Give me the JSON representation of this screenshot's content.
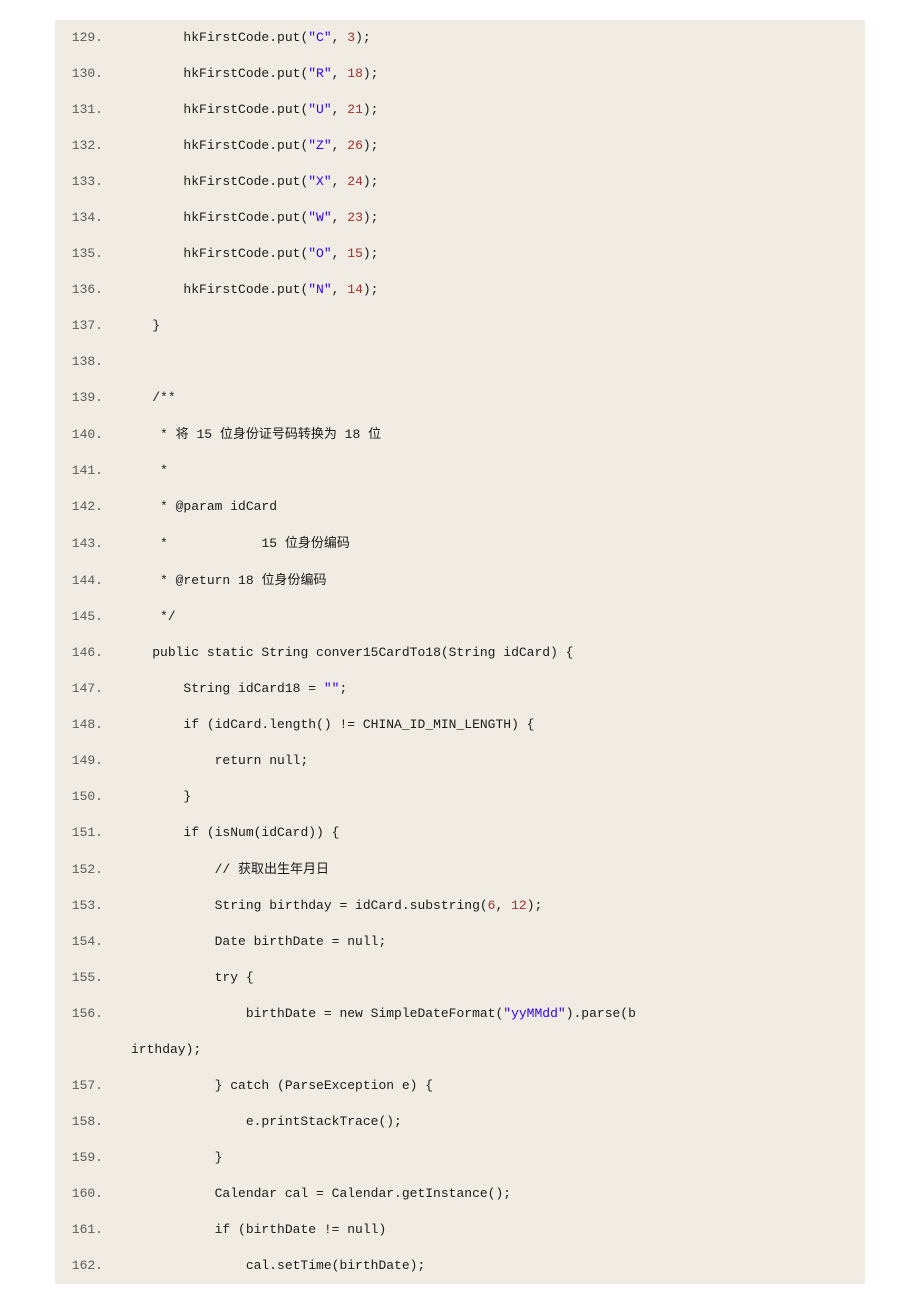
{
  "lines": [
    {
      "n": "129.",
      "indent": "        ",
      "segs": [
        {
          "t": "hkFirstCode.put("
        },
        {
          "t": "\"C\"",
          "c": "str"
        },
        {
          "t": ", "
        },
        {
          "t": "3",
          "c": "num"
        },
        {
          "t": ");"
        }
      ]
    },
    {
      "n": "130.",
      "indent": "        ",
      "segs": [
        {
          "t": "hkFirstCode.put("
        },
        {
          "t": "\"R\"",
          "c": "str"
        },
        {
          "t": ", "
        },
        {
          "t": "18",
          "c": "num"
        },
        {
          "t": ");"
        }
      ]
    },
    {
      "n": "131.",
      "indent": "        ",
      "segs": [
        {
          "t": "hkFirstCode.put("
        },
        {
          "t": "\"U\"",
          "c": "str"
        },
        {
          "t": ", "
        },
        {
          "t": "21",
          "c": "num"
        },
        {
          "t": ");"
        }
      ]
    },
    {
      "n": "132.",
      "indent": "        ",
      "segs": [
        {
          "t": "hkFirstCode.put("
        },
        {
          "t": "\"Z\"",
          "c": "str"
        },
        {
          "t": ", "
        },
        {
          "t": "26",
          "c": "num"
        },
        {
          "t": ");"
        }
      ]
    },
    {
      "n": "133.",
      "indent": "        ",
      "segs": [
        {
          "t": "hkFirstCode.put("
        },
        {
          "t": "\"X\"",
          "c": "str"
        },
        {
          "t": ", "
        },
        {
          "t": "24",
          "c": "num"
        },
        {
          "t": ");"
        }
      ]
    },
    {
      "n": "134.",
      "indent": "        ",
      "segs": [
        {
          "t": "hkFirstCode.put("
        },
        {
          "t": "\"W\"",
          "c": "str"
        },
        {
          "t": ", "
        },
        {
          "t": "23",
          "c": "num"
        },
        {
          "t": ");"
        }
      ]
    },
    {
      "n": "135.",
      "indent": "        ",
      "segs": [
        {
          "t": "hkFirstCode.put("
        },
        {
          "t": "\"O\"",
          "c": "str"
        },
        {
          "t": ", "
        },
        {
          "t": "15",
          "c": "num"
        },
        {
          "t": ");"
        }
      ]
    },
    {
      "n": "136.",
      "indent": "        ",
      "segs": [
        {
          "t": "hkFirstCode.put("
        },
        {
          "t": "\"N\"",
          "c": "str"
        },
        {
          "t": ", "
        },
        {
          "t": "14",
          "c": "num"
        },
        {
          "t": ");"
        }
      ]
    },
    {
      "n": "137.",
      "indent": "    ",
      "segs": [
        {
          "t": "}"
        }
      ]
    },
    {
      "n": "138.",
      "indent": "",
      "segs": [
        {
          "t": ""
        }
      ]
    },
    {
      "n": "139.",
      "indent": "    ",
      "segs": [
        {
          "t": "/**"
        }
      ]
    },
    {
      "n": "140.",
      "indent": "     ",
      "segs": [
        {
          "t": "* "
        },
        {
          "t": "将",
          "c": "cjk"
        },
        {
          "t": " 15 "
        },
        {
          "t": "位身份证号码转换为",
          "c": "cjk"
        },
        {
          "t": " 18 "
        },
        {
          "t": "位",
          "c": "cjk"
        }
      ]
    },
    {
      "n": "141.",
      "indent": "     ",
      "segs": [
        {
          "t": "*"
        }
      ]
    },
    {
      "n": "142.",
      "indent": "     ",
      "segs": [
        {
          "t": "* @param idCard"
        }
      ]
    },
    {
      "n": "143.",
      "indent": "     ",
      "segs": [
        {
          "t": "*            15 "
        },
        {
          "t": "位身份编码",
          "c": "cjk"
        }
      ]
    },
    {
      "n": "144.",
      "indent": "     ",
      "segs": [
        {
          "t": "* @return 18 "
        },
        {
          "t": "位身份编码",
          "c": "cjk"
        }
      ]
    },
    {
      "n": "145.",
      "indent": "     ",
      "segs": [
        {
          "t": "*/"
        }
      ]
    },
    {
      "n": "146.",
      "indent": "    ",
      "segs": [
        {
          "t": "public static String conver15CardTo18(String idCard) {"
        }
      ]
    },
    {
      "n": "147.",
      "indent": "        ",
      "segs": [
        {
          "t": "String idCard18 = "
        },
        {
          "t": "\"\"",
          "c": "str"
        },
        {
          "t": ";"
        }
      ]
    },
    {
      "n": "148.",
      "indent": "        ",
      "segs": [
        {
          "t": "if (idCard.length() != CHINA_ID_MIN_LENGTH) {"
        }
      ]
    },
    {
      "n": "149.",
      "indent": "            ",
      "segs": [
        {
          "t": "return null;"
        }
      ]
    },
    {
      "n": "150.",
      "indent": "        ",
      "segs": [
        {
          "t": "}"
        }
      ]
    },
    {
      "n": "151.",
      "indent": "        ",
      "segs": [
        {
          "t": "if (isNum(idCard)) {"
        }
      ]
    },
    {
      "n": "152.",
      "indent": "            ",
      "segs": [
        {
          "t": "// "
        },
        {
          "t": "获取出生年月日",
          "c": "cjk"
        }
      ]
    },
    {
      "n": "153.",
      "indent": "            ",
      "segs": [
        {
          "t": "String birthday = idCard.substring("
        },
        {
          "t": "6",
          "c": "num"
        },
        {
          "t": ", "
        },
        {
          "t": "12",
          "c": "num"
        },
        {
          "t": ");"
        }
      ]
    },
    {
      "n": "154.",
      "indent": "            ",
      "segs": [
        {
          "t": "Date birthDate = null;"
        }
      ]
    },
    {
      "n": "155.",
      "indent": "            ",
      "segs": [
        {
          "t": "try {"
        }
      ]
    },
    {
      "n": "156.",
      "indent": "                ",
      "segs": [
        {
          "t": "birthDate = new SimpleDateFormat("
        },
        {
          "t": "\"yyMMdd\"",
          "c": "str"
        },
        {
          "t": ").parse(b"
        }
      ]
    },
    {
      "n": "",
      "indent": "",
      "segs": [
        {
          "t": "irthday);"
        }
      ],
      "cont": true
    },
    {
      "n": "157.",
      "indent": "            ",
      "segs": [
        {
          "t": "} catch (ParseException e) {"
        }
      ]
    },
    {
      "n": "158.",
      "indent": "                ",
      "segs": [
        {
          "t": "e.printStackTrace();"
        }
      ]
    },
    {
      "n": "159.",
      "indent": "            ",
      "segs": [
        {
          "t": "}"
        }
      ]
    },
    {
      "n": "160.",
      "indent": "            ",
      "segs": [
        {
          "t": "Calendar cal = Calendar.getInstance();"
        }
      ]
    },
    {
      "n": "161.",
      "indent": "            ",
      "segs": [
        {
          "t": "if (birthDate != null)"
        }
      ]
    },
    {
      "n": "162.",
      "indent": "                ",
      "segs": [
        {
          "t": "cal.setTime(birthDate);"
        }
      ]
    }
  ]
}
